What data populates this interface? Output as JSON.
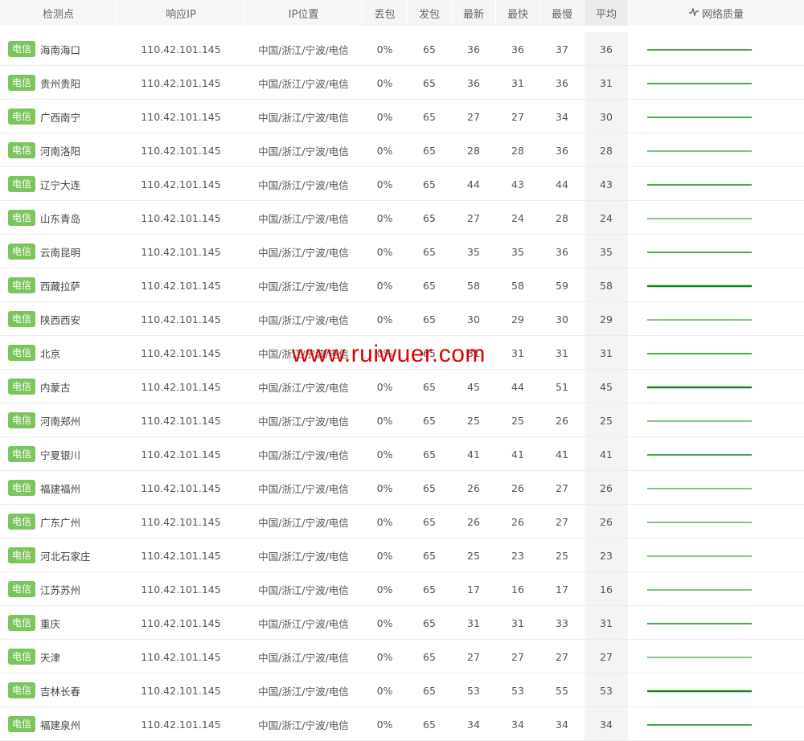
{
  "header": {
    "site": "检测点",
    "ip": "响应IP",
    "location": "IP位置",
    "loss": "丢包",
    "sent": "发包",
    "last": "最新",
    "best": "最快",
    "worst": "最慢",
    "avg": "平均",
    "quality": "网络质量",
    "quality_icon": "pulse-icon"
  },
  "watermark": "www.ruiwuer.com",
  "colors": {
    "badge": "#7cc45c",
    "spark": "#118a11",
    "watermark": "#e00000"
  },
  "rows": [
    {
      "isp": "电信",
      "site": "海南海口",
      "ip": "110.42.101.145",
      "loc": "中国/浙江/宁波/电信",
      "loss": "0%",
      "sent": "65",
      "last": "36",
      "best": "36",
      "worst": "37",
      "avg": "36"
    },
    {
      "isp": "电信",
      "site": "贵州贵阳",
      "ip": "110.42.101.145",
      "loc": "中国/浙江/宁波/电信",
      "loss": "0%",
      "sent": "65",
      "last": "36",
      "best": "31",
      "worst": "36",
      "avg": "31"
    },
    {
      "isp": "电信",
      "site": "广西南宁",
      "ip": "110.42.101.145",
      "loc": "中国/浙江/宁波/电信",
      "loss": "0%",
      "sent": "65",
      "last": "27",
      "best": "27",
      "worst": "34",
      "avg": "30"
    },
    {
      "isp": "电信",
      "site": "河南洛阳",
      "ip": "110.42.101.145",
      "loc": "中国/浙江/宁波/电信",
      "loss": "0%",
      "sent": "65",
      "last": "28",
      "best": "28",
      "worst": "36",
      "avg": "28"
    },
    {
      "isp": "电信",
      "site": "辽宁大连",
      "ip": "110.42.101.145",
      "loc": "中国/浙江/宁波/电信",
      "loss": "0%",
      "sent": "65",
      "last": "44",
      "best": "43",
      "worst": "44",
      "avg": "43"
    },
    {
      "isp": "电信",
      "site": "山东青岛",
      "ip": "110.42.101.145",
      "loc": "中国/浙江/宁波/电信",
      "loss": "0%",
      "sent": "65",
      "last": "27",
      "best": "24",
      "worst": "28",
      "avg": "24"
    },
    {
      "isp": "电信",
      "site": "云南昆明",
      "ip": "110.42.101.145",
      "loc": "中国/浙江/宁波/电信",
      "loss": "0%",
      "sent": "65",
      "last": "35",
      "best": "35",
      "worst": "36",
      "avg": "35"
    },
    {
      "isp": "电信",
      "site": "西藏拉萨",
      "ip": "110.42.101.145",
      "loc": "中国/浙江/宁波/电信",
      "loss": "0%",
      "sent": "65",
      "last": "58",
      "best": "58",
      "worst": "59",
      "avg": "58"
    },
    {
      "isp": "电信",
      "site": "陕西西安",
      "ip": "110.42.101.145",
      "loc": "中国/浙江/宁波/电信",
      "loss": "0%",
      "sent": "65",
      "last": "30",
      "best": "29",
      "worst": "30",
      "avg": "29"
    },
    {
      "isp": "电信",
      "site": "北京",
      "ip": "110.42.101.145",
      "loc": "中国/浙江/宁波/电信",
      "loss": "0%",
      "sent": "65",
      "last": "31",
      "best": "31",
      "worst": "31",
      "avg": "31"
    },
    {
      "isp": "电信",
      "site": "内蒙古",
      "ip": "110.42.101.145",
      "loc": "中国/浙江/宁波/电信",
      "loss": "0%",
      "sent": "65",
      "last": "45",
      "best": "44",
      "worst": "51",
      "avg": "45"
    },
    {
      "isp": "电信",
      "site": "河南郑州",
      "ip": "110.42.101.145",
      "loc": "中国/浙江/宁波/电信",
      "loss": "0%",
      "sent": "65",
      "last": "25",
      "best": "25",
      "worst": "26",
      "avg": "25"
    },
    {
      "isp": "电信",
      "site": "宁夏银川",
      "ip": "110.42.101.145",
      "loc": "中国/浙江/宁波/电信",
      "loss": "0%",
      "sent": "65",
      "last": "41",
      "best": "41",
      "worst": "41",
      "avg": "41"
    },
    {
      "isp": "电信",
      "site": "福建福州",
      "ip": "110.42.101.145",
      "loc": "中国/浙江/宁波/电信",
      "loss": "0%",
      "sent": "65",
      "last": "26",
      "best": "26",
      "worst": "27",
      "avg": "26"
    },
    {
      "isp": "电信",
      "site": "广东广州",
      "ip": "110.42.101.145",
      "loc": "中国/浙江/宁波/电信",
      "loss": "0%",
      "sent": "65",
      "last": "26",
      "best": "26",
      "worst": "27",
      "avg": "26"
    },
    {
      "isp": "电信",
      "site": "河北石家庄",
      "ip": "110.42.101.145",
      "loc": "中国/浙江/宁波/电信",
      "loss": "0%",
      "sent": "65",
      "last": "25",
      "best": "23",
      "worst": "25",
      "avg": "23"
    },
    {
      "isp": "电信",
      "site": "江苏苏州",
      "ip": "110.42.101.145",
      "loc": "中国/浙江/宁波/电信",
      "loss": "0%",
      "sent": "65",
      "last": "17",
      "best": "16",
      "worst": "17",
      "avg": "16"
    },
    {
      "isp": "电信",
      "site": "重庆",
      "ip": "110.42.101.145",
      "loc": "中国/浙江/宁波/电信",
      "loss": "0%",
      "sent": "65",
      "last": "31",
      "best": "31",
      "worst": "33",
      "avg": "31"
    },
    {
      "isp": "电信",
      "site": "天津",
      "ip": "110.42.101.145",
      "loc": "中国/浙江/宁波/电信",
      "loss": "0%",
      "sent": "65",
      "last": "27",
      "best": "27",
      "worst": "27",
      "avg": "27"
    },
    {
      "isp": "电信",
      "site": "吉林长春",
      "ip": "110.42.101.145",
      "loc": "中国/浙江/宁波/电信",
      "loss": "0%",
      "sent": "65",
      "last": "53",
      "best": "53",
      "worst": "55",
      "avg": "53"
    },
    {
      "isp": "电信",
      "site": "福建泉州",
      "ip": "110.42.101.145",
      "loc": "中国/浙江/宁波/电信",
      "loss": "0%",
      "sent": "65",
      "last": "34",
      "best": "34",
      "worst": "34",
      "avg": "34"
    }
  ]
}
